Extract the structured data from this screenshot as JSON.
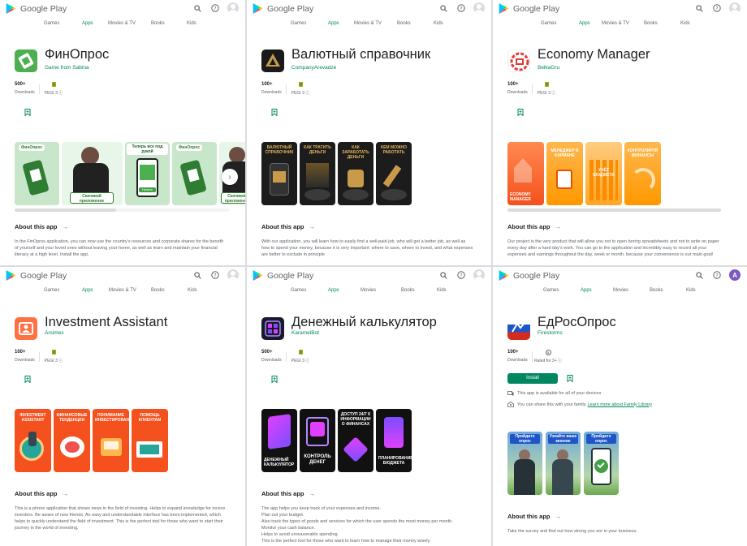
{
  "header": {
    "brand": "Google Play"
  },
  "nav": {
    "games": "Games",
    "apps": "Apps",
    "movies_tv": "Movies & TV",
    "movies": "Movies",
    "books": "Books",
    "kids": "Kids"
  },
  "colors": {
    "accent": "#01875f",
    "brand_text": "#5f6368"
  },
  "icons": [
    "search-icon",
    "help-icon",
    "account-icon",
    "bookmark-icon",
    "chevron-right-icon",
    "arrow-right-icon"
  ],
  "common": {
    "about": "About this app",
    "pegi": "PEGI 3",
    "downloads": "Downloads"
  },
  "panels": [
    {
      "title": "ФинОпрос",
      "developer": "Game from Sabina",
      "downloads": "500+",
      "screenshot_text": [
        "ФинОпрос",
        "Скачивай приложение",
        "Теперь все под рукой",
        "Начать",
        "ФинОпрос",
        "Скачивай приложения"
      ],
      "description": [
        "In the FinOpros application, you can now use the country's resources and corporate shares for the benefit",
        "of yourself and your loved ones without leaving your home, as well as learn and maintain your financial",
        "literacy at a high level. Install the app."
      ]
    },
    {
      "title": "Валютный справочник",
      "developer": "CompanyArevadze",
      "downloads": "100+",
      "screenshot_text": [
        "Валютный справочник",
        "Как тратить деньги",
        "Как заработать деньги",
        "Кем можно работать"
      ],
      "description": [
        "With our application, you will learn how to easily find a well-paid job, who will get a better job, as well as",
        "how to spend your money, because it is very important: where to save, where to invest, and what expenses",
        "are better to exclude in principle"
      ]
    },
    {
      "title": "Economy Manager",
      "developer": "BelkaGru",
      "downloads": "100+",
      "screenshot_text": [
        "Economy Manager",
        "Менеджер в кармане",
        "Учёт бюджета",
        "Контролируй финансы"
      ],
      "description": [
        "Our project is the very product that will allow you not to open boring spreadsheets and not to write on paper",
        "every day after a hard day's work. You can go to the application and incredibly easy to record all your",
        "expenses and earnings throughout the day, week or month, because your convenience is our main goal!"
      ]
    },
    {
      "title": "Investment Assistant",
      "developer": "Arsimes",
      "downloads": "100+",
      "screenshot_text": [
        "Investment Assistant",
        "Финансовые тенденции",
        "Понимание инвестирования",
        "Помощь клиентам"
      ],
      "description": [
        "This is a phone application that shows news in the field of investing. Helps to expand knowledge for novice",
        "investors. Be aware of new friends. An easy and understandable interface has been implemented, which",
        "helps to quickly understand the field of investment. This is the perfect tool for those who want to start their",
        "journey in the world of investing."
      ]
    },
    {
      "title": "Денежный калькулятор",
      "developer": "KaramelBot",
      "downloads": "500+",
      "screenshot_text": [
        "Денежный калькулятор",
        "Контроль денег",
        "Доступ 24/7 к информации о финансах",
        "Планирование бюджета"
      ],
      "description": [
        "The app helps you keep track of your expenses and income.",
        "Plan out your budget.",
        "Also track the types of goods and services for which the user spends the most money per month.",
        "Monitor your cash balance.",
        "Helps to avoid unreasonable spending.",
        "This is the perfect tool for those who want to learn how to manage their money wisely."
      ]
    },
    {
      "title": "ЕдРосОпрос",
      "developer": "Firestorms",
      "downloads": "100+",
      "rated": "Rated for 3+",
      "install": "Install",
      "availability": "This app is available for all of your devices",
      "family_text": "You can share this with your family.",
      "family_link": "Learn more about Family Library",
      "avatar_letter": "A",
      "screenshot_text": [
        "Пройдите опрос",
        "Узнайте ваше мнение",
        "Пройдите опрос"
      ],
      "description": [
        "Take the survey and find out how strong you are in your business."
      ]
    }
  ]
}
